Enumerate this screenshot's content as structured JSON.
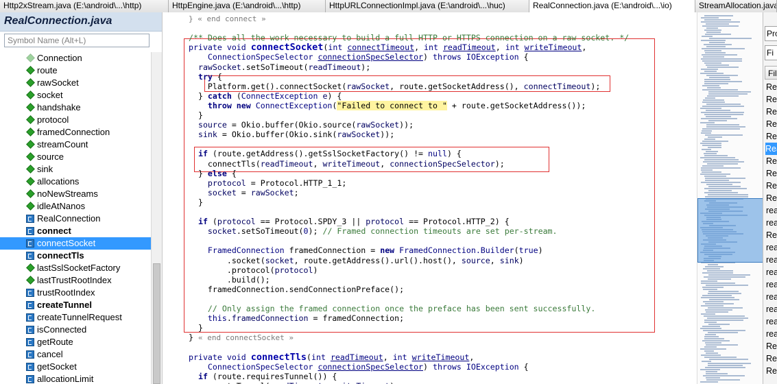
{
  "tabs": [
    {
      "label": "Http2xStream.java (E:\\android\\...\\http)",
      "width": 246,
      "active": false
    },
    {
      "label": "HttpEngine.java (E:\\android\\...\\http)",
      "width": 229,
      "active": false
    },
    {
      "label": "HttpURLConnectionImpl.java (E:\\android\\...\\huc)",
      "width": 297,
      "active": false
    },
    {
      "label": "RealConnection.java (E:\\android\\...\\io)",
      "width": 242,
      "active": true
    },
    {
      "label": "StreamAllocation.java (E:\\android\\...",
      "width": 119,
      "active": false
    }
  ],
  "symbol_panel": {
    "title": "RealConnection.java",
    "search_placeholder": "Symbol Name (Alt+L)",
    "items": [
      {
        "label": "Connection",
        "kind": "field-gray",
        "bold": false,
        "selected": false
      },
      {
        "label": "route",
        "kind": "field",
        "bold": false,
        "selected": false
      },
      {
        "label": "rawSocket",
        "kind": "field",
        "bold": false,
        "selected": false
      },
      {
        "label": "socket",
        "kind": "field",
        "bold": false,
        "selected": false
      },
      {
        "label": "handshake",
        "kind": "field",
        "bold": false,
        "selected": false
      },
      {
        "label": "protocol",
        "kind": "field",
        "bold": false,
        "selected": false
      },
      {
        "label": "framedConnection",
        "kind": "field",
        "bold": false,
        "selected": false
      },
      {
        "label": "streamCount",
        "kind": "field",
        "bold": false,
        "selected": false
      },
      {
        "label": "source",
        "kind": "field",
        "bold": false,
        "selected": false
      },
      {
        "label": "sink",
        "kind": "field",
        "bold": false,
        "selected": false
      },
      {
        "label": "allocations",
        "kind": "field",
        "bold": false,
        "selected": false
      },
      {
        "label": "noNewStreams",
        "kind": "field",
        "bold": false,
        "selected": false
      },
      {
        "label": "idleAtNanos",
        "kind": "field",
        "bold": false,
        "selected": false
      },
      {
        "label": "RealConnection",
        "kind": "method",
        "bold": false,
        "selected": false
      },
      {
        "label": "connect",
        "kind": "method",
        "bold": true,
        "selected": false
      },
      {
        "label": "connectSocket",
        "kind": "method",
        "bold": false,
        "selected": true
      },
      {
        "label": "connectTls",
        "kind": "method",
        "bold": true,
        "selected": false
      },
      {
        "label": "lastSslSocketFactory",
        "kind": "field",
        "bold": false,
        "selected": false
      },
      {
        "label": "lastTrustRootIndex",
        "kind": "field",
        "bold": false,
        "selected": false
      },
      {
        "label": "trustRootIndex",
        "kind": "method",
        "bold": false,
        "selected": false
      },
      {
        "label": "createTunnel",
        "kind": "method",
        "bold": true,
        "selected": false
      },
      {
        "label": "createTunnelRequest",
        "kind": "method",
        "bold": false,
        "selected": false
      },
      {
        "label": "isConnected",
        "kind": "method",
        "bold": false,
        "selected": false
      },
      {
        "label": "getRoute",
        "kind": "method",
        "bold": false,
        "selected": false
      },
      {
        "label": "cancel",
        "kind": "method",
        "bold": false,
        "selected": false
      },
      {
        "label": "getSocket",
        "kind": "method",
        "bold": false,
        "selected": false
      },
      {
        "label": "allocationLimit",
        "kind": "method",
        "bold": false,
        "selected": false
      }
    ]
  },
  "code_lines": [
    [
      [
        "fg",
        "} « end connect »"
      ]
    ],
    [],
    [
      [
        "cmt",
        "/** Does all the work necessary to build a full HTTP or HTTPS connection on a raw socket. */"
      ]
    ],
    [
      [
        "kw",
        "private void "
      ],
      [
        "fn",
        "connectSocket"
      ],
      [
        "call",
        "("
      ],
      [
        "kw",
        "int "
      ],
      [
        "par",
        "connectTimeout"
      ],
      [
        "call",
        ", "
      ],
      [
        "kw",
        "int "
      ],
      [
        "par",
        "readTimeout"
      ],
      [
        "call",
        ", "
      ],
      [
        "kw",
        "int "
      ],
      [
        "par",
        "writeTimeout"
      ],
      [
        "call",
        ","
      ]
    ],
    [
      [
        "ty",
        "    ConnectionSpecSelector "
      ],
      [
        "par",
        "connectionSpecSelector"
      ],
      [
        "call",
        ") "
      ],
      [
        "kw",
        "throws "
      ],
      [
        "ty",
        "IOException "
      ],
      [
        "call",
        "{"
      ]
    ],
    [
      [
        "idf",
        "  rawSocket"
      ],
      [
        "call",
        ".setSoTimeout("
      ],
      [
        "idf",
        "readTimeout"
      ],
      [
        "call",
        ");"
      ]
    ],
    [
      [
        "kwb",
        "  try "
      ],
      [
        "call",
        "{"
      ]
    ],
    [
      [
        "call",
        "    Platform.get().connectSocket("
      ],
      [
        "idf",
        "rawSocket"
      ],
      [
        "call",
        ", route.getSocketAddress(), "
      ],
      [
        "idf",
        "connectTimeout"
      ],
      [
        "call",
        ");"
      ]
    ],
    [
      [
        "call",
        "  } "
      ],
      [
        "kwb",
        "catch "
      ],
      [
        "call",
        "("
      ],
      [
        "ty",
        "ConnectException "
      ],
      [
        "idf",
        "e"
      ],
      [
        "call",
        ") {"
      ]
    ],
    [
      [
        "kwb",
        "    throw new "
      ],
      [
        "ty",
        "ConnectException"
      ],
      [
        "call",
        "("
      ],
      [
        "str",
        "\"Failed to connect to \""
      ],
      [
        "call",
        " + route.getSocketAddress());"
      ]
    ],
    [
      [
        "call",
        "  }"
      ]
    ],
    [
      [
        "idf",
        "  source"
      ],
      [
        "call",
        " = Okio.buffer(Okio.source("
      ],
      [
        "idf",
        "rawSocket"
      ],
      [
        "call",
        "));"
      ]
    ],
    [
      [
        "idf",
        "  sink"
      ],
      [
        "call",
        " = Okio.buffer(Okio.sink("
      ],
      [
        "idf",
        "rawSocket"
      ],
      [
        "call",
        "));"
      ]
    ],
    [],
    [
      [
        "kwb",
        "  if "
      ],
      [
        "call",
        "(route.getAddress().getSslSocketFactory() != "
      ],
      [
        "kw",
        "null"
      ],
      [
        "call",
        ") {"
      ]
    ],
    [
      [
        "call",
        "    connectTls("
      ],
      [
        "idf",
        "readTimeout"
      ],
      [
        "call",
        ", "
      ],
      [
        "idf",
        "writeTimeout"
      ],
      [
        "call",
        ", "
      ],
      [
        "idf",
        "connectionSpecSelector"
      ],
      [
        "call",
        ");"
      ]
    ],
    [
      [
        "call",
        "  } "
      ],
      [
        "kwb",
        "else "
      ],
      [
        "call",
        "{"
      ]
    ],
    [
      [
        "idf",
        "    protocol"
      ],
      [
        "call",
        " = Protocol.HTTP_1_1;"
      ]
    ],
    [
      [
        "idf",
        "    socket"
      ],
      [
        "call",
        " = "
      ],
      [
        "idf",
        "rawSocket"
      ],
      [
        "call",
        ";"
      ]
    ],
    [
      [
        "call",
        "  }"
      ]
    ],
    [],
    [
      [
        "kwb",
        "  if "
      ],
      [
        "call",
        "("
      ],
      [
        "idf",
        "protocol"
      ],
      [
        "call",
        " == Protocol.SPDY_3 || "
      ],
      [
        "idf",
        "protocol"
      ],
      [
        "call",
        " == Protocol.HTTP_2) {"
      ]
    ],
    [
      [
        "idf",
        "    socket"
      ],
      [
        "call",
        ".setSoTimeout("
      ],
      [
        "kw",
        "0"
      ],
      [
        "call",
        "); "
      ],
      [
        "cmt",
        "// Framed connection timeouts are set per-stream."
      ]
    ],
    [],
    [
      [
        "ty",
        "    FramedConnection "
      ],
      [
        "call",
        "framedConnection = "
      ],
      [
        "kwb",
        "new "
      ],
      [
        "ty",
        "FramedConnection.Builder"
      ],
      [
        "call",
        "("
      ],
      [
        "kw",
        "true"
      ],
      [
        "call",
        ")"
      ]
    ],
    [
      [
        "call",
        "        .socket("
      ],
      [
        "idf",
        "socket"
      ],
      [
        "call",
        ", route.getAddress().url().host(), "
      ],
      [
        "idf",
        "source"
      ],
      [
        "call",
        ", "
      ],
      [
        "idf",
        "sink"
      ],
      [
        "call",
        ")"
      ]
    ],
    [
      [
        "call",
        "        .protocol("
      ],
      [
        "idf",
        "protocol"
      ],
      [
        "call",
        ")"
      ]
    ],
    [
      [
        "call",
        "        .build();"
      ]
    ],
    [
      [
        "call",
        "    framedConnection.sendConnectionPreface();"
      ]
    ],
    [],
    [
      [
        "cmt",
        "    // Only assign the framed connection once the preface has been sent successfully."
      ]
    ],
    [
      [
        "kw",
        "    this"
      ],
      [
        "call",
        "."
      ],
      [
        "idf",
        "framedConnection"
      ],
      [
        "call",
        " = framedConnection;"
      ]
    ],
    [
      [
        "call",
        "  }"
      ]
    ],
    [
      [
        "call",
        "} "
      ],
      [
        "fg",
        "« end connectSocket »"
      ]
    ],
    [],
    [
      [
        "kw",
        "private void "
      ],
      [
        "fn",
        "connectTls"
      ],
      [
        "call",
        "("
      ],
      [
        "kw",
        "int "
      ],
      [
        "par",
        "readTimeout"
      ],
      [
        "call",
        ", "
      ],
      [
        "kw",
        "int "
      ],
      [
        "par",
        "writeTimeout"
      ],
      [
        "call",
        ","
      ]
    ],
    [
      [
        "ty",
        "    ConnectionSpecSelector "
      ],
      [
        "par",
        "connectionSpecSelector"
      ],
      [
        "call",
        ") "
      ],
      [
        "kw",
        "throws "
      ],
      [
        "ty",
        "IOException "
      ],
      [
        "call",
        "{"
      ]
    ],
    [
      [
        "kwb",
        "  if "
      ],
      [
        "call",
        "(route.requiresTunnel()) {"
      ]
    ],
    [
      [
        "call",
        "    createTunnel("
      ],
      [
        "idf",
        "readTimeout"
      ],
      [
        "call",
        ", "
      ],
      [
        "idf",
        "writeTimeout"
      ],
      [
        "call",
        ");"
      ]
    ]
  ],
  "right_panel": {
    "top_label": "Pro",
    "input_value": "Fi",
    "header_label": "File",
    "items": [
      {
        "label": "Rea",
        "selected": false
      },
      {
        "label": "Rea",
        "selected": false
      },
      {
        "label": "Rea",
        "selected": false
      },
      {
        "label": "Rea",
        "selected": false
      },
      {
        "label": "Rea",
        "selected": false
      },
      {
        "label": "Rea",
        "selected": true
      },
      {
        "label": "Rea",
        "selected": false
      },
      {
        "label": "Rea",
        "selected": false
      },
      {
        "label": "Rea",
        "selected": false
      },
      {
        "label": "Rea",
        "selected": false
      },
      {
        "label": "rea",
        "selected": false
      },
      {
        "label": "rea",
        "selected": false
      },
      {
        "label": "Rea",
        "selected": false
      },
      {
        "label": "rea",
        "selected": false
      },
      {
        "label": "rea",
        "selected": false
      },
      {
        "label": "rea",
        "selected": false
      },
      {
        "label": "rea",
        "selected": false
      },
      {
        "label": "rea",
        "selected": false
      },
      {
        "label": "rea",
        "selected": false
      },
      {
        "label": "rea",
        "selected": false
      },
      {
        "label": "rea",
        "selected": false
      },
      {
        "label": "Rea",
        "selected": false
      },
      {
        "label": "Rea",
        "selected": false
      },
      {
        "label": "Rea",
        "selected": false
      }
    ]
  },
  "colors": {
    "accent_selection": "#3399ff",
    "highlight_box": "#e03030",
    "panel_title_bg": "#d3e0ee"
  }
}
